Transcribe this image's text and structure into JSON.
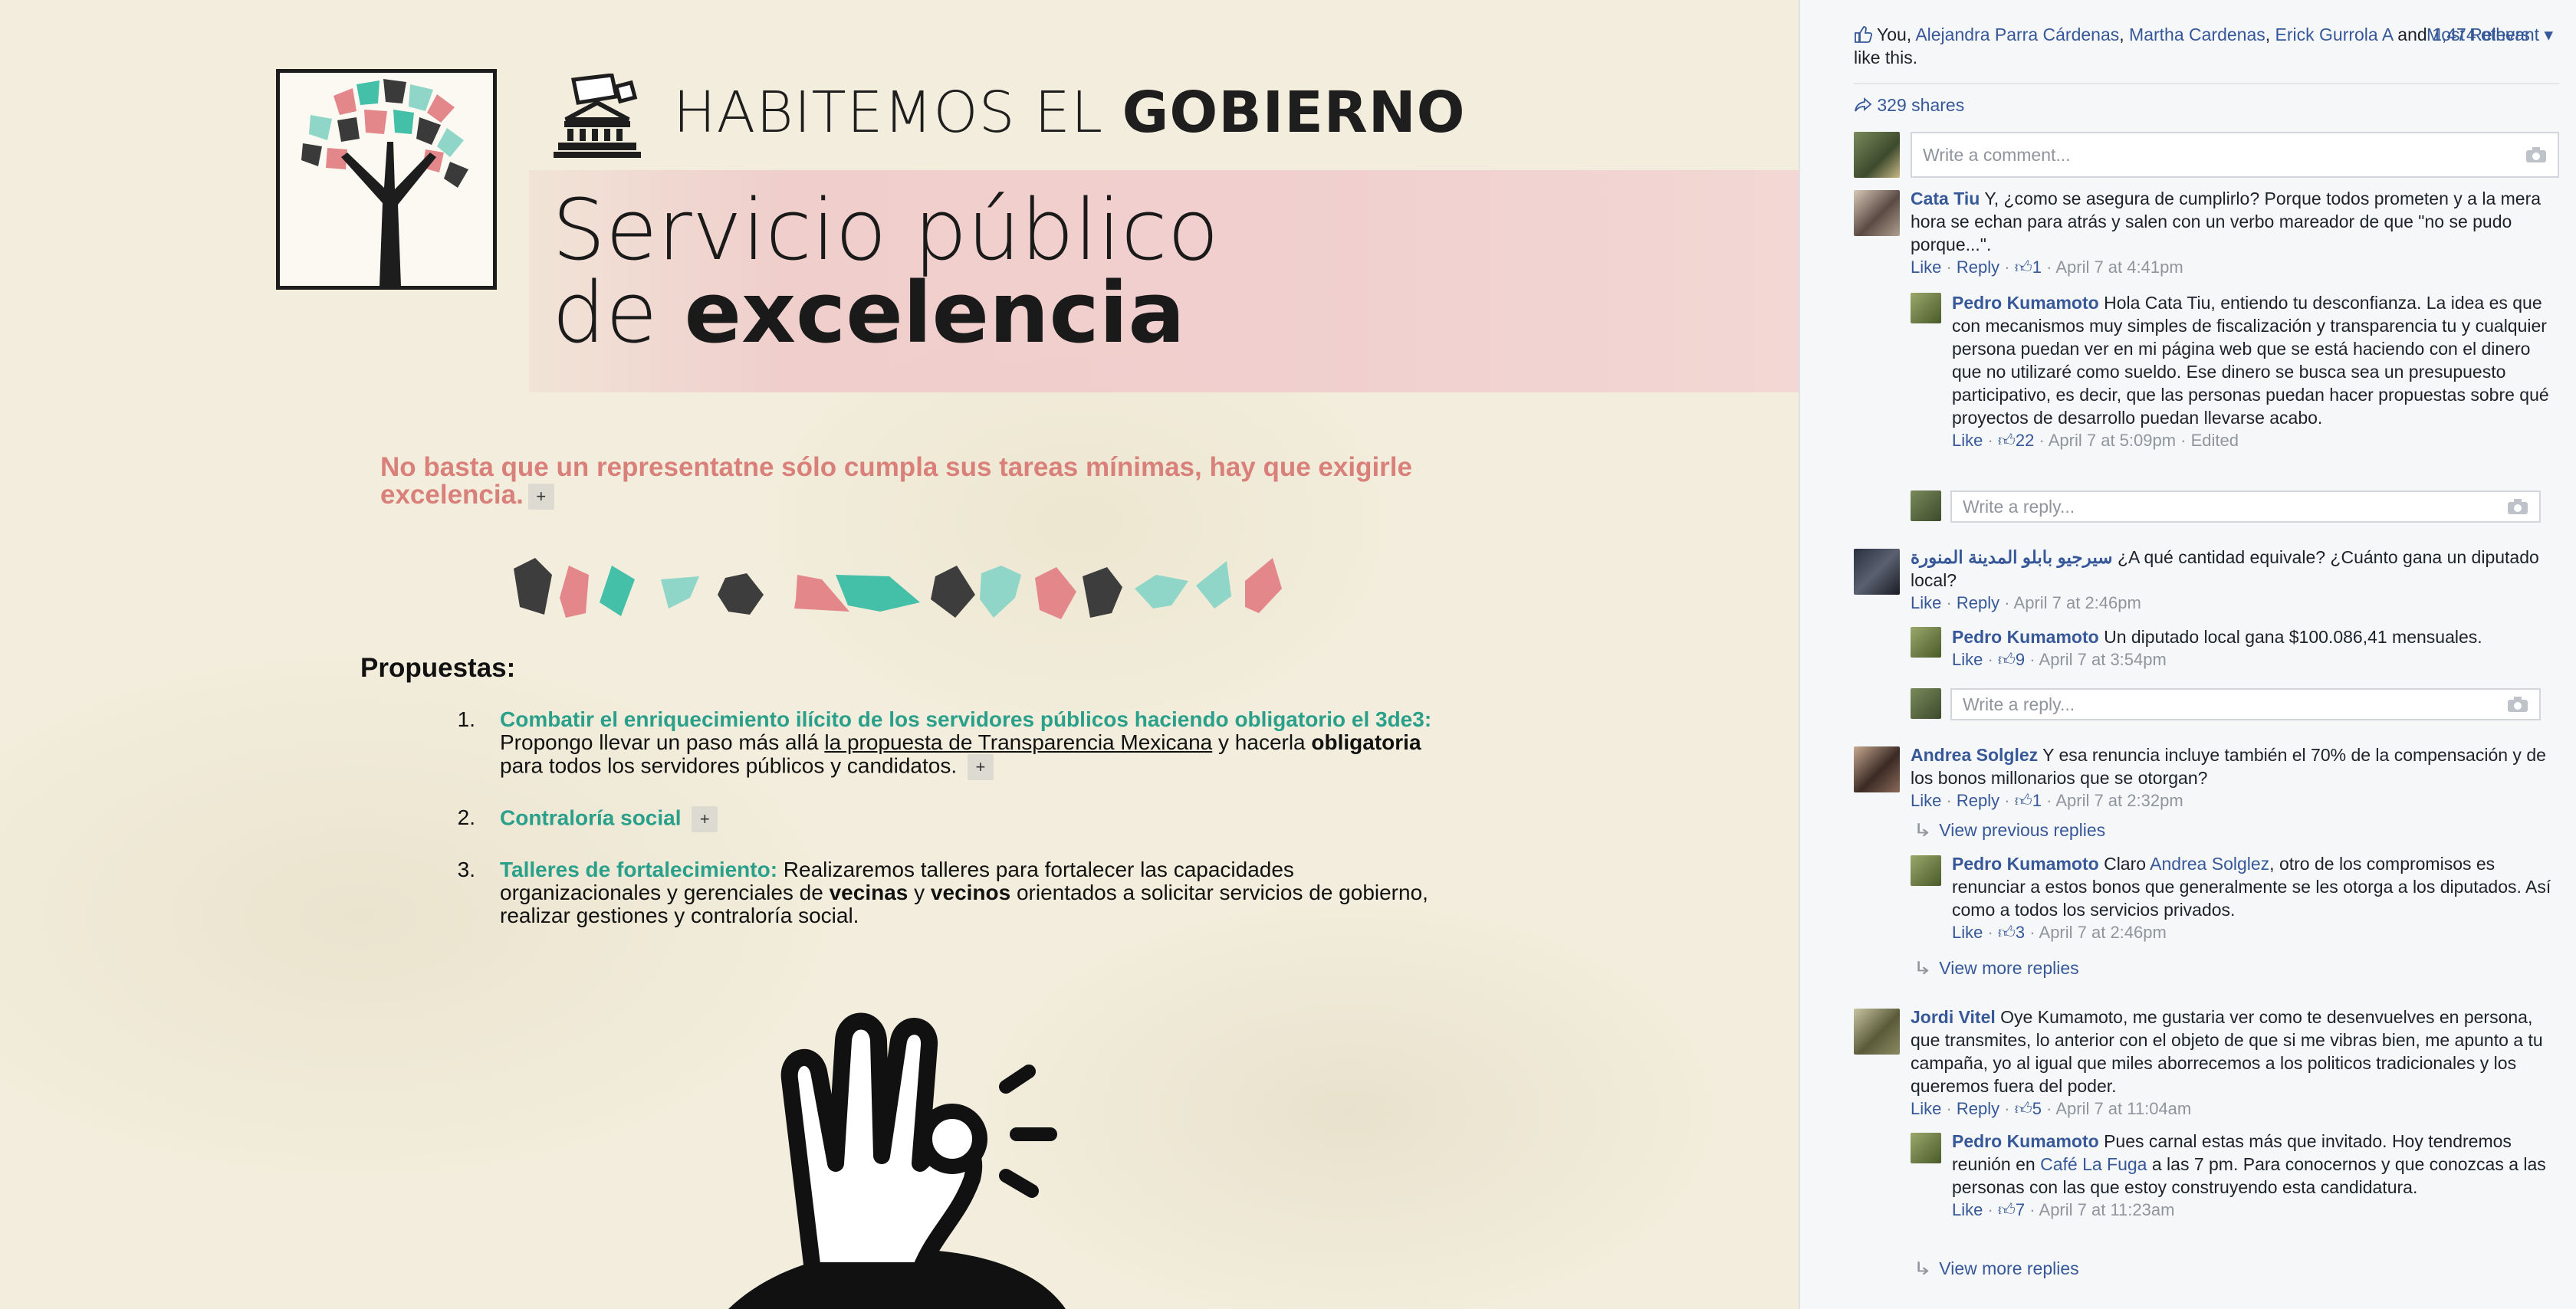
{
  "site": {
    "brand_light": "HABITEMOS EL",
    "brand_bold": "GOBIERNO",
    "headline_line1": "Servicio público",
    "headline_line2_light": "de",
    "headline_line2_bold": "excelencia",
    "tagline": "No basta que un representatne sólo cumpla sus tareas mínimas, hay que exigirle excelencia.",
    "expand_label": "+",
    "propuestas_title": "Propuestas:",
    "proposals": [
      {
        "num": "1.",
        "head": "Combatir el enriquecimiento ilícito de los servidores públicos haciendo obligatorio el 3de3:",
        "text_a": " Propongo llevar un paso más allá ",
        "link": "la propuesta de Transparencia Mexicana",
        "text_b": " y hacerla ",
        "bold": "obligatoria",
        "text_c": " para todos los servidores públicos y candidatos."
      },
      {
        "num": "2.",
        "head": "Contraloría social"
      },
      {
        "num": "3.",
        "head": "Talleres de fortalecimiento:",
        "text_a": " Realizaremos talleres para fortalecer las capacidades organizacionales y gerenciales de ",
        "bold1": "vecinas",
        "text_b": " y ",
        "bold2": "vecinos",
        "text_c": " orientados a solicitar servicios de gobierno, realizar gestiones y contraloría social."
      }
    ],
    "colors": {
      "teal": "#2aa08b",
      "pink": "#d9807b",
      "dark": "#1e1e1e"
    }
  },
  "facebook": {
    "likes": {
      "you": "You,",
      "names": [
        "Alejandra Parra Cárdenas",
        "Martha Cardenas",
        "Erick Gurrola A"
      ],
      "and_text": "and",
      "others": "1,474 others",
      "suffix": "like this."
    },
    "sort_label": "Most Relevant",
    "shares": "329 shares",
    "comment_placeholder": "Write a comment...",
    "reply_placeholder": "Write a reply...",
    "view_previous": "View previous replies",
    "view_more": "View more replies",
    "meta_like": "Like",
    "meta_reply": "Reply",
    "comments": [
      {
        "name": "Cata Tiu",
        "text": "Y, ¿como se asegura de cumplirlo? Porque todos prometen y a la mera hora se echan para atrás y salen con un verbo mareador de que \"no se pudo porque...\".",
        "likes": "1",
        "time": "April 7 at 4:41pm",
        "reply": {
          "name": "Pedro Kumamoto",
          "text": "Hola Cata Tiu, entiendo tu desconfianza. La idea es que con mecanismos muy simples de fiscalización y transparencia tu y cualquier persona puedan ver en mi página web que se está haciendo con el dinero que no utilizaré como sueldo. Ese dinero se busca sea un presupuesto participativo, es decir, que las personas puedan hacer propuestas sobre qué proyectos de desarrollo puedan llevarse acabo.",
          "likes": "22",
          "time": "April 7 at 5:09pm",
          "edited": "Edited"
        }
      },
      {
        "name": "سيرجيو بابلو المدينة المنورة",
        "text": "¿A qué cantidad equivale? ¿Cuánto gana un diputado local?",
        "time": "April 7 at 2:46pm",
        "reply": {
          "name": "Pedro Kumamoto",
          "text": "Un diputado local gana $100.086,41 mensuales.",
          "likes": "9",
          "time": "April 7 at 3:54pm"
        }
      },
      {
        "name": "Andrea Solglez",
        "text": "Y esa renuncia incluye también el 70% de la compensación y de los bonos millonarios que se otorgan?",
        "likes": "1",
        "time": "April 7 at 2:32pm",
        "reply": {
          "name": "Pedro Kumamoto",
          "text_a": "Claro ",
          "mention": "Andrea Solglez",
          "text_b": ", otro de los compromisos es renunciar a estos bonos que generalmente se les otorga a los diputados. Así como a todos los servicios privados.",
          "likes": "3",
          "time": "April 7 at 2:46pm"
        }
      },
      {
        "name": "Jordi Vitel",
        "text": "Oye Kumamoto, me gustaria ver como te desenvuelves en persona, que transmites, lo anterior con el objeto de que si me vibras bien, me apunto a tu campaña, yo al igual que miles aborrecemos a los politicos tradicionales y los queremos fuera del poder.",
        "likes": "5",
        "time": "April 7 at 11:04am",
        "reply": {
          "name": "Pedro Kumamoto",
          "text_a": "Pues carnal estas más que invitado. Hoy tendremos reunión en ",
          "mention": "Café La Fuga",
          "text_b": " a las 7 pm. Para conocernos y que conozcas a las personas con las que estoy construyendo esta candidatura.",
          "likes": "7",
          "time": "April 7 at 11:23am"
        }
      }
    ]
  }
}
